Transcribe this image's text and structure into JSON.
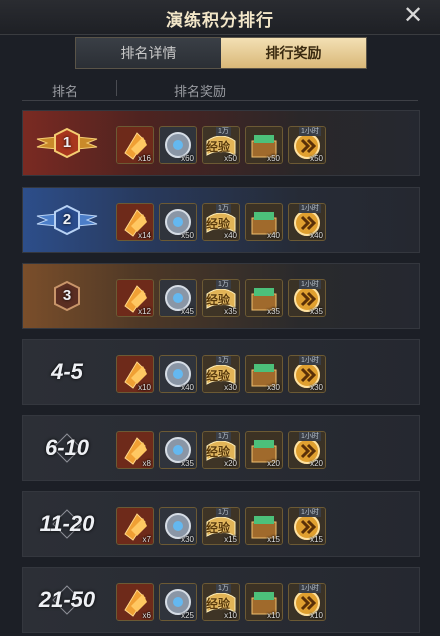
{
  "header": {
    "title": "演练积分排行",
    "close_glyph": "✕"
  },
  "tabs": [
    {
      "label": "排名详情",
      "active": false
    },
    {
      "label": "排行奖励",
      "active": true
    }
  ],
  "columns": {
    "rank": "排名",
    "reward": "排名奖励"
  },
  "item_tags": {
    "exp_top": "1万",
    "exp_label": "经验",
    "speed_top": "1小时"
  },
  "rows": [
    {
      "rank": "1",
      "badge": "gold-wing-medal",
      "qty": [
        "x16",
        "x60",
        "x50",
        "x50",
        "x50"
      ]
    },
    {
      "rank": "2",
      "badge": "blue-wing-medal",
      "qty": [
        "x14",
        "x50",
        "x40",
        "x40",
        "x40"
      ]
    },
    {
      "rank": "3",
      "badge": "bronze-medal",
      "qty": [
        "x12",
        "x45",
        "x35",
        "x35",
        "x35"
      ]
    },
    {
      "rank": "4-5",
      "badge": "none",
      "qty": [
        "x10",
        "x40",
        "x30",
        "x30",
        "x30"
      ]
    },
    {
      "rank": "6-10",
      "badge": "diamond-outline",
      "qty": [
        "x8",
        "x35",
        "x20",
        "x20",
        "x20"
      ]
    },
    {
      "rank": "11-20",
      "badge": "diamond-outline",
      "qty": [
        "x7",
        "x30",
        "x15",
        "x15",
        "x15"
      ]
    },
    {
      "rank": "21-50",
      "badge": "diamond-outline",
      "qty": [
        "x6",
        "x25",
        "x10",
        "x10",
        "x10"
      ]
    }
  ],
  "item_icons": [
    "golden-ticket-icon",
    "gear-core-icon",
    "exp-book-icon",
    "supply-chest-icon",
    "speedup-icon"
  ],
  "colors": {
    "gold": "#d9b878",
    "rank1": "#7a2a22",
    "rank2": "#2d4e8a",
    "rank3": "#7a4e2a"
  }
}
